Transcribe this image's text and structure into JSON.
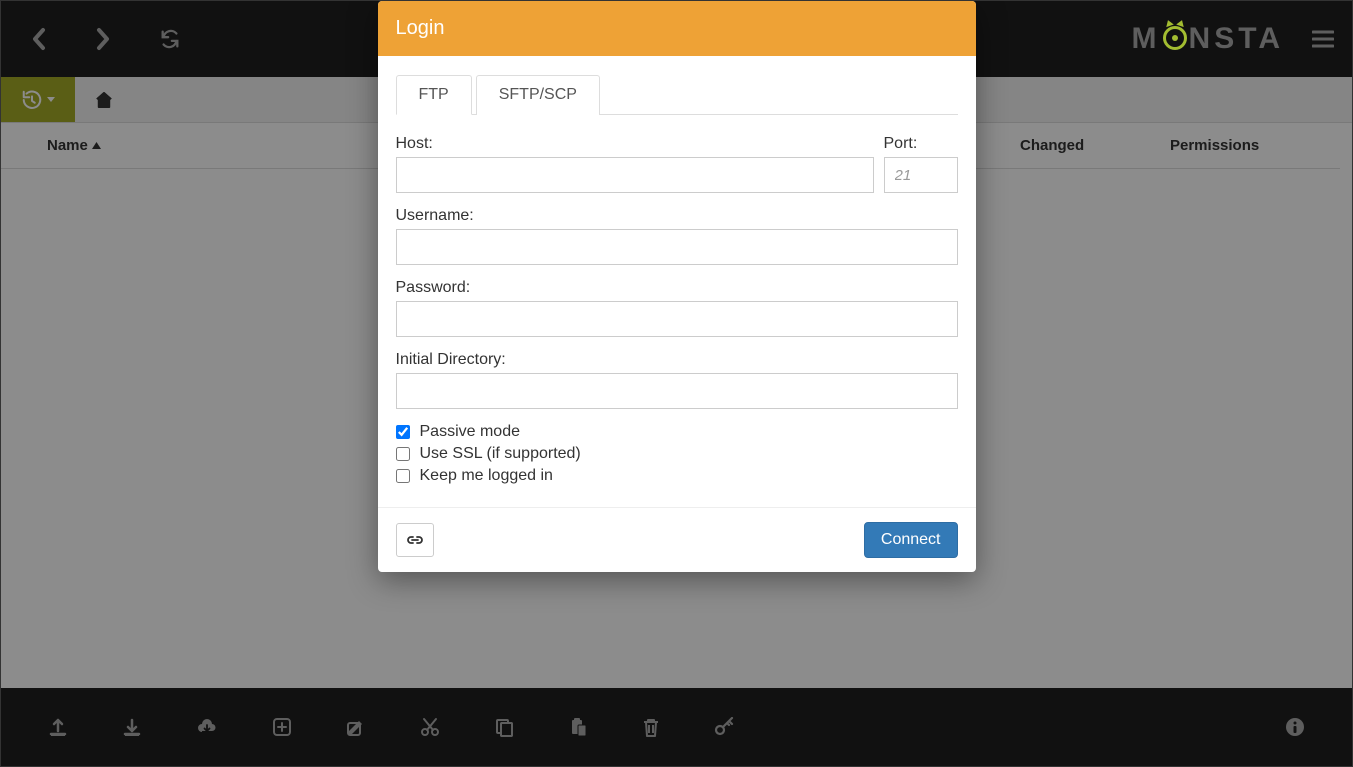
{
  "logo": {
    "text_before": "M",
    "text_after": "NSTA"
  },
  "columns": {
    "name": "Name",
    "changed": "Changed",
    "permissions": "Permissions"
  },
  "modal": {
    "title": "Login",
    "tabs": {
      "ftp": "FTP",
      "sftp": "SFTP/SCP"
    },
    "labels": {
      "host": "Host:",
      "port": "Port:",
      "username": "Username:",
      "password": "Password:",
      "initial_dir": "Initial Directory:"
    },
    "port_placeholder": "21",
    "checks": {
      "passive": "Passive mode",
      "ssl": "Use SSL (if supported)",
      "keep": "Keep me logged in"
    },
    "connect": "Connect"
  }
}
